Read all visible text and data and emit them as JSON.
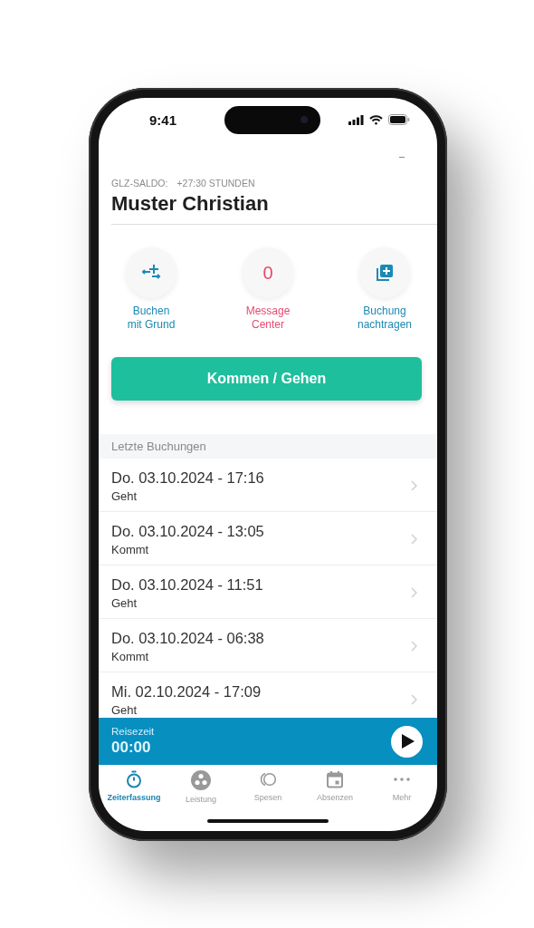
{
  "status_bar": {
    "time": "9:41"
  },
  "header": {
    "balance_label": "GLZ-SALDO:",
    "balance_value": "+27:30 STUNDEN",
    "name": "Muster Christian"
  },
  "actions": [
    {
      "kind": "icon",
      "label": "Buchen\nmit Grund"
    },
    {
      "kind": "count",
      "value": "0",
      "label": "Message\nCenter"
    },
    {
      "kind": "icon",
      "label": "Buchung\nnachtragen"
    }
  ],
  "primary_button": "Kommen / Gehen",
  "section_title": "Letzte Buchungen",
  "bookings": [
    {
      "datetime": "Do. 03.10.2024 - 17:16",
      "type": "Geht"
    },
    {
      "datetime": "Do. 03.10.2024 - 13:05",
      "type": "Kommt"
    },
    {
      "datetime": "Do. 03.10.2024 - 11:51",
      "type": "Geht"
    },
    {
      "datetime": "Do. 03.10.2024 - 06:38",
      "type": "Kommt"
    },
    {
      "datetime": "Mi. 02.10.2024 - 17:09",
      "type": "Geht"
    }
  ],
  "travel": {
    "label": "Reisezeit",
    "time": "00:00"
  },
  "tabs": [
    {
      "label": "Zeiterfassung",
      "selected": true
    },
    {
      "label": "Leistung",
      "selected": false
    },
    {
      "label": "Spesen",
      "selected": false
    },
    {
      "label": "Absenzen",
      "selected": false
    },
    {
      "label": "Mehr",
      "selected": false
    }
  ]
}
